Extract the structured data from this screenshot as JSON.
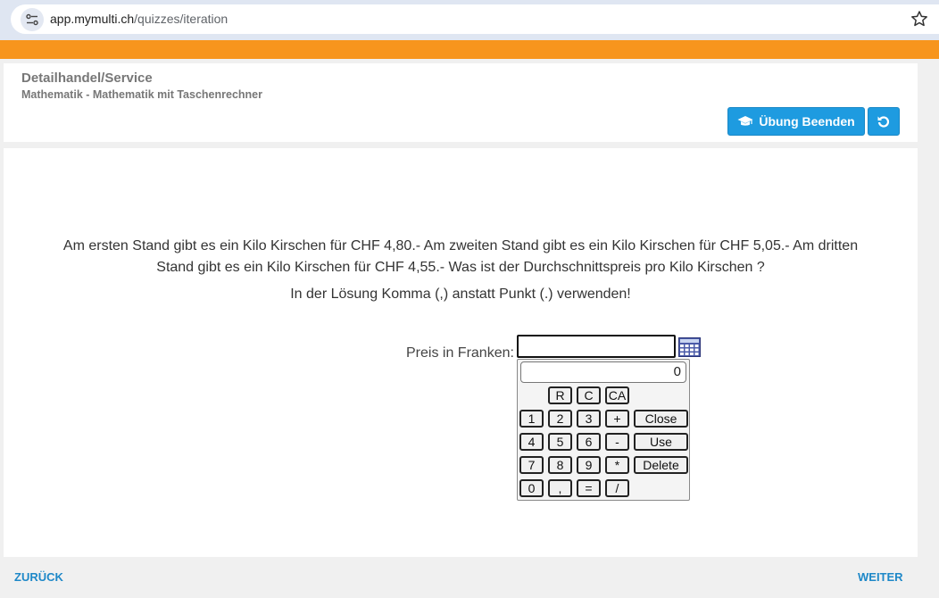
{
  "browser": {
    "url_domain": "app.mymulti.ch",
    "url_path": "/quizzes/iteration"
  },
  "header": {
    "title": "Detailhandel/Service",
    "subtitle": "Mathematik - Mathematik mit Taschenrechner",
    "finish_label": "Übung Beenden",
    "accent_color": "#1e9be0",
    "brand_color": "#f7951d"
  },
  "question": {
    "text": "Am ersten Stand gibt es ein Kilo Kirschen für CHF 4,80.- Am zweiten Stand gibt es ein Kilo Kirschen für CHF 5,05.- Am dritten Stand gibt es ein Kilo Kirschen für CHF 4,55.- Was ist der Durchschnittspreis pro Kilo Kirschen ?",
    "hint": "In der Lösung Komma (,) anstatt Punkt (.) verwenden!",
    "answer_label": "Preis in Franken:",
    "answer_value": ""
  },
  "calculator": {
    "display": "0",
    "keys": {
      "r": "R",
      "c": "C",
      "ca": "CA",
      "k1": "1",
      "k2": "2",
      "k3": "3",
      "plus": "+",
      "close": "Close",
      "k4": "4",
      "k5": "5",
      "k6": "6",
      "minus": "-",
      "use": "Use",
      "k7": "7",
      "k8": "8",
      "k9": "9",
      "mult": "*",
      "delete": "Delete",
      "k0": "0",
      "comma": ",",
      "equals": "=",
      "div": "/"
    }
  },
  "footer": {
    "back_label": "ZURÜCK",
    "next_label": "WEITER"
  }
}
